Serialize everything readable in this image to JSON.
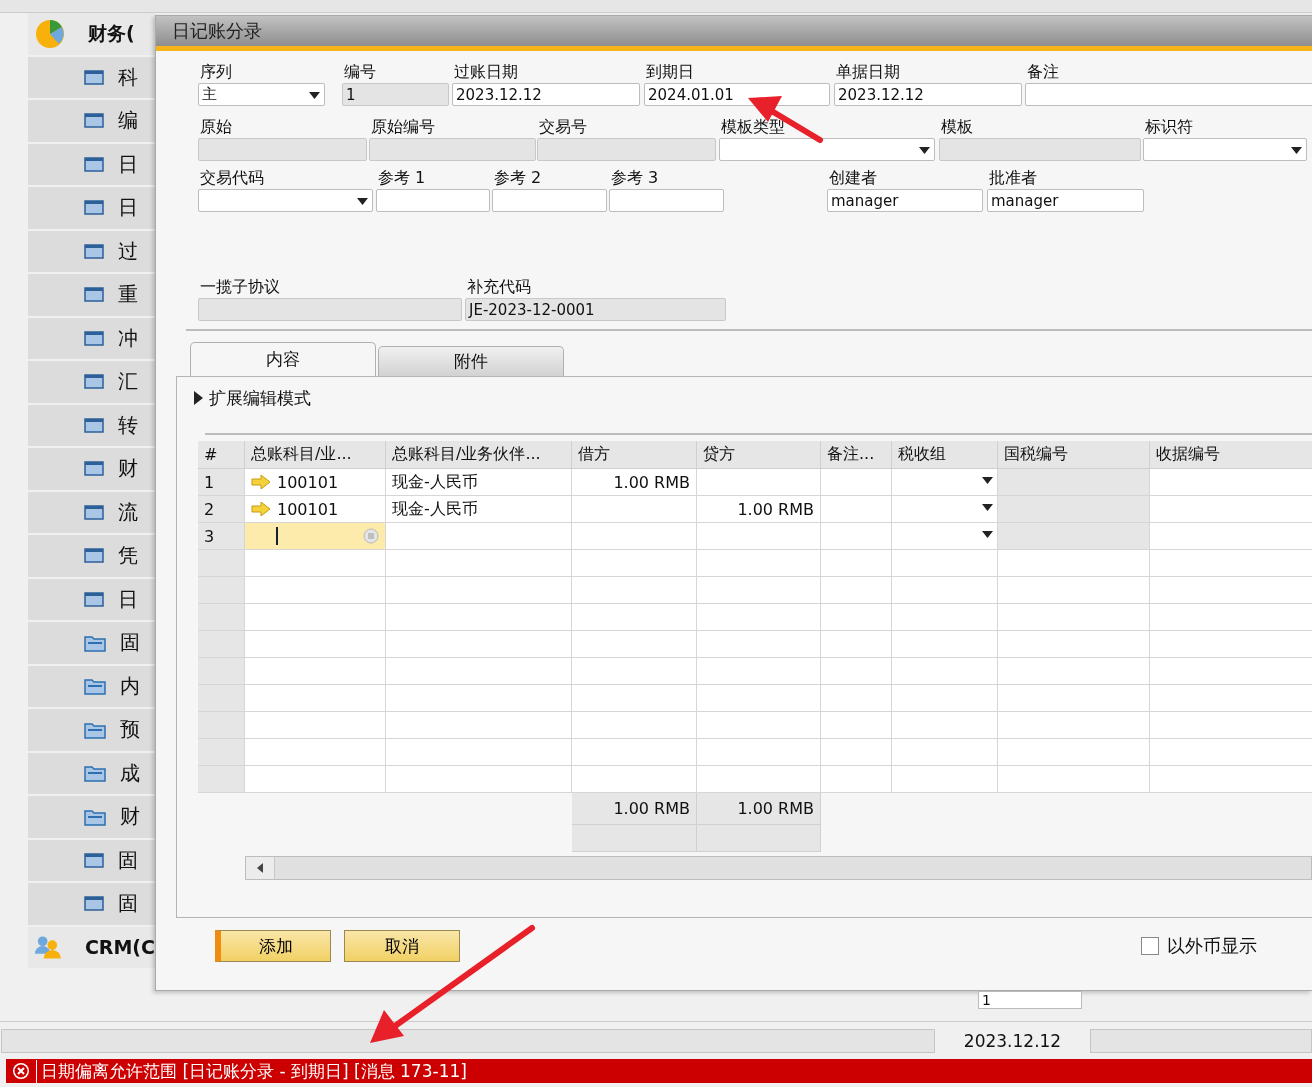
{
  "sidebar": {
    "items": [
      {
        "kind": "module",
        "label": "财务("
      },
      {
        "kind": "form",
        "label": "科"
      },
      {
        "kind": "form",
        "label": "编"
      },
      {
        "kind": "form",
        "label": "日"
      },
      {
        "kind": "form",
        "label": "日"
      },
      {
        "kind": "form",
        "label": "过"
      },
      {
        "kind": "form",
        "label": "重"
      },
      {
        "kind": "form",
        "label": "冲"
      },
      {
        "kind": "form",
        "label": "汇"
      },
      {
        "kind": "form",
        "label": "转"
      },
      {
        "kind": "form",
        "label": "财"
      },
      {
        "kind": "form",
        "label": "流"
      },
      {
        "kind": "form",
        "label": "凭"
      },
      {
        "kind": "form",
        "label": "日"
      },
      {
        "kind": "folder",
        "label": "固"
      },
      {
        "kind": "folder",
        "label": "内"
      },
      {
        "kind": "folder",
        "label": "预"
      },
      {
        "kind": "folder",
        "label": "成"
      },
      {
        "kind": "folder",
        "label": "财"
      },
      {
        "kind": "form",
        "label": "固"
      },
      {
        "kind": "form",
        "label": "固"
      },
      {
        "kind": "module",
        "label": "CRM(C"
      }
    ]
  },
  "dialog": {
    "title": "日记账分录"
  },
  "form": {
    "header_fields": [
      {
        "label": "序列",
        "kind": "dropdown",
        "value": "主",
        "disabled": false
      },
      {
        "label": "编号",
        "kind": "text",
        "value": "1",
        "disabled": true
      },
      {
        "label": "过账日期",
        "kind": "text",
        "value": "2023.12.12",
        "disabled": false
      },
      {
        "label": "到期日",
        "kind": "text",
        "value": "2024.01.01",
        "disabled": false
      },
      {
        "label": "单据日期",
        "kind": "text",
        "value": "2023.12.12",
        "disabled": false
      },
      {
        "label": "备注",
        "kind": "text",
        "disabled": false
      }
    ],
    "source_fields": [
      {
        "label": "原始",
        "kind": "text",
        "disabled": true
      },
      {
        "label": "原始编号",
        "kind": "text",
        "disabled": true
      },
      {
        "label": "交易号",
        "kind": "text",
        "disabled": true
      },
      {
        "label": "模板类型",
        "kind": "dropdown",
        "disabled": false
      },
      {
        "label": "模板",
        "kind": "text",
        "disabled": true
      },
      {
        "label": "标识符",
        "kind": "dropdown",
        "disabled": false
      }
    ],
    "reference_fields": [
      {
        "label": "交易代码",
        "kind": "dropdown",
        "disabled": false
      },
      {
        "label": "参考 1",
        "kind": "text",
        "disabled": false
      },
      {
        "label": "参考 2",
        "kind": "text",
        "disabled": false
      },
      {
        "label": "参考 3",
        "kind": "text",
        "disabled": false
      },
      {
        "label": "创建者",
        "kind": "text",
        "value": "manager",
        "disabled": false
      },
      {
        "label": "批准者",
        "kind": "text",
        "value": "manager",
        "disabled": false
      }
    ],
    "agreement_fields": [
      {
        "label": "一揽子协议",
        "kind": "text",
        "disabled": true
      },
      {
        "label": "补充代码",
        "kind": "text",
        "value": "JE-2023-12-0001",
        "disabled": true
      }
    ]
  },
  "tabs": [
    {
      "label": "内容",
      "selected": true
    },
    {
      "label": "附件",
      "selected": false
    }
  ],
  "expand_toggle": {
    "label": "扩展编辑模式"
  },
  "table": {
    "columns": [
      "#",
      "总账科目/业...",
      "总账科目/业务伙伴...",
      "借方",
      "贷方",
      "备注...",
      "税收组",
      "国税编号",
      "收据编号"
    ],
    "rows": [
      {
        "number": "1",
        "account": "100101",
        "name": "现金-人民币",
        "debit": "1.00 RMB",
        "active": false
      },
      {
        "number": "2",
        "account": "100101",
        "name": "现金-人民币",
        "credit": "1.00 RMB",
        "active": false
      },
      {
        "number": "3",
        "active": true
      }
    ],
    "totals": {
      "debit": "1.00 RMB",
      "credit": "1.00 RMB"
    }
  },
  "buttons": [
    {
      "label": "添加",
      "kind": "primary"
    },
    {
      "label": "取消",
      "kind": "secondary"
    }
  ],
  "foreign_currency": {
    "label": "以外币显示",
    "checked": false
  },
  "background_field": {
    "value": "1"
  },
  "status_bar": {
    "date": "2023.12.12"
  },
  "error": {
    "message": "日期偏离允许范围 [日记账分录 - 到期日] [消息 173-11]"
  }
}
